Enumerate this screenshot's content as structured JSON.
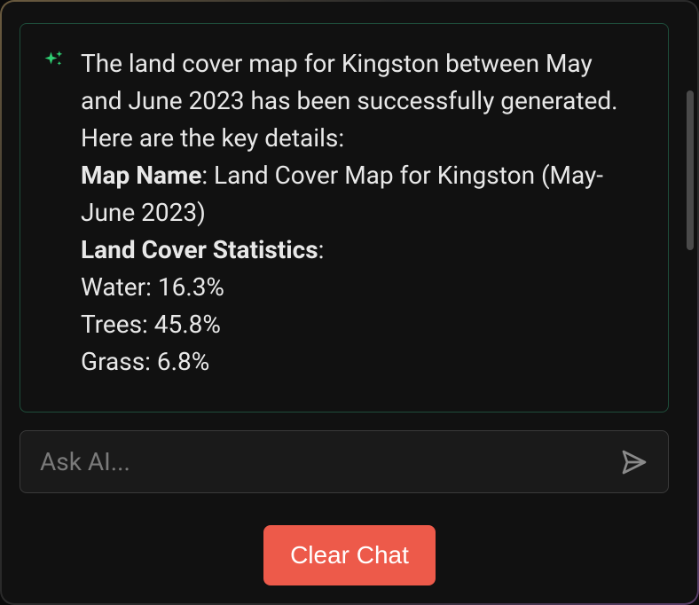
{
  "message": {
    "intro": "The land cover map for Kingston between May and June 2023 has been successfully generated. Here are the key details:",
    "mapNameLabel": "Map Name",
    "mapNameValue": ": Land Cover Map for Kingston (May-June 2023)",
    "statsLabel": "Land Cover Statistics",
    "statsColon": ":",
    "stats": {
      "water": "Water: 16.3%",
      "trees": "Trees: 45.8%",
      "grass": "Grass: 6.8%"
    }
  },
  "input": {
    "placeholder": "Ask AI..."
  },
  "buttons": {
    "clearChat": "Clear Chat"
  }
}
